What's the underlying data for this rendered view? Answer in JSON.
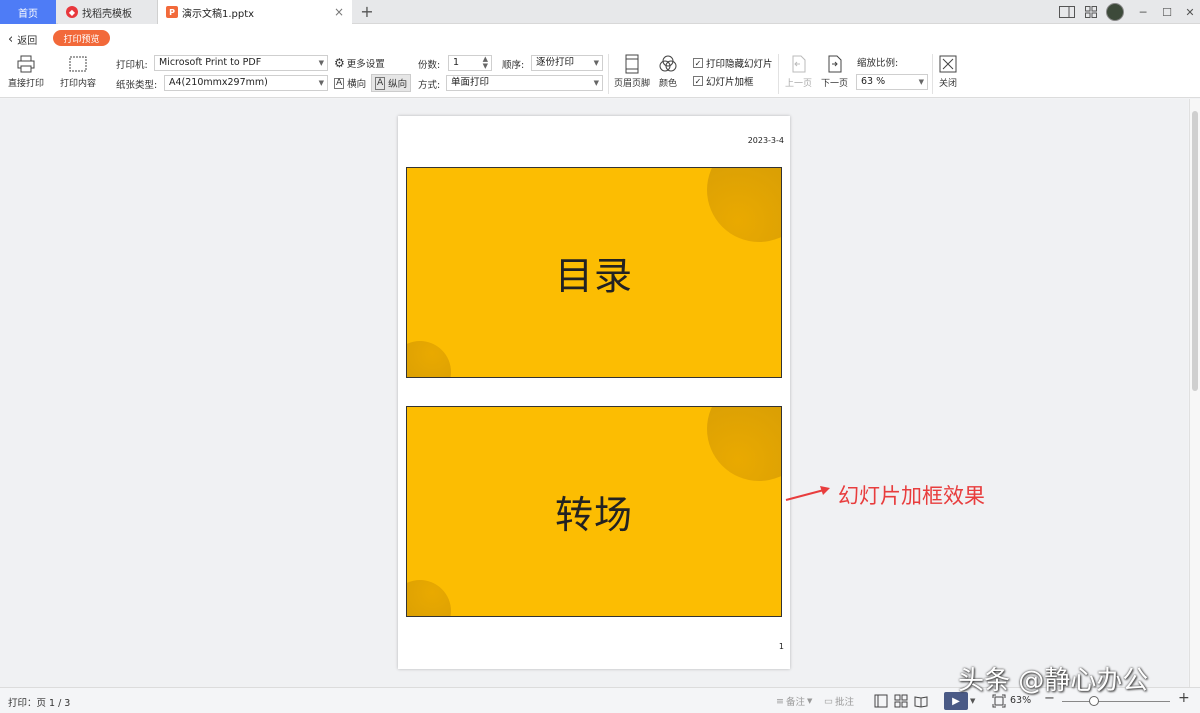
{
  "tabs": {
    "home": "首页",
    "docer": "找稻壳模板",
    "document": "演示文稿1.pptx",
    "close_glyph": "×",
    "add_glyph": "+"
  },
  "window_controls": [
    "─",
    "☐",
    "✕"
  ],
  "toolbar": {
    "back": "返回",
    "print_preview": "打印预览",
    "direct_print": "直接打印",
    "print_content": "打印内容",
    "printer_label": "打印机:",
    "printer_value": "Microsoft Print to PDF",
    "paper_label": "纸张类型:",
    "paper_value": "A4(210mmx297mm)",
    "more_settings": "更多设置",
    "landscape": "横向",
    "portrait": "纵向",
    "copies_label": "份数:",
    "copies_value": "1",
    "order_label": "顺序:",
    "order_value": "逐份打印",
    "mode_label": "方式:",
    "mode_value": "单面打印",
    "header_footer": "页眉页脚",
    "color": "颜色",
    "print_hidden_slides": "打印隐藏幻灯片",
    "print_hidden_checked": true,
    "frame_slides": "幻灯片加框",
    "frame_slides_checked": true,
    "prev_page": "上一页",
    "next_page": "下一页",
    "zoom_label": "缩放比例:",
    "zoom_value": "63 %",
    "close": "关闭"
  },
  "page": {
    "date": "2023-3-4",
    "number": "1",
    "slides": [
      {
        "title": "目录"
      },
      {
        "title": "转场"
      }
    ]
  },
  "annotation": "幻灯片加框效果",
  "watermark": "头条 @静心办公",
  "statusbar": {
    "print_status": "打印：页 1 / 3",
    "notes": "备注",
    "comments": "批注",
    "zoom": "63%",
    "minus": "−",
    "plus": "+"
  },
  "colors": {
    "accent": "#f2693a",
    "home_tab": "#4e7cf6",
    "slide_bg": "#fcbd02",
    "annotation": "#e83d3d"
  }
}
